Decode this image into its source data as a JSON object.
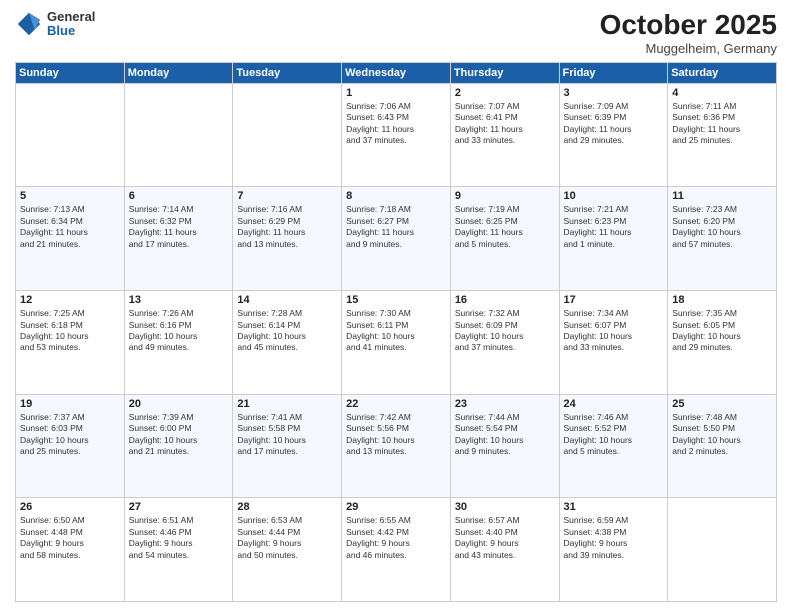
{
  "logo": {
    "general": "General",
    "blue": "Blue"
  },
  "header": {
    "month": "October 2025",
    "location": "Muggelheim, Germany"
  },
  "weekdays": [
    "Sunday",
    "Monday",
    "Tuesday",
    "Wednesday",
    "Thursday",
    "Friday",
    "Saturday"
  ],
  "weeks": [
    [
      {
        "day": "",
        "info": ""
      },
      {
        "day": "",
        "info": ""
      },
      {
        "day": "",
        "info": ""
      },
      {
        "day": "1",
        "info": "Sunrise: 7:06 AM\nSunset: 6:43 PM\nDaylight: 11 hours\nand 37 minutes."
      },
      {
        "day": "2",
        "info": "Sunrise: 7:07 AM\nSunset: 6:41 PM\nDaylight: 11 hours\nand 33 minutes."
      },
      {
        "day": "3",
        "info": "Sunrise: 7:09 AM\nSunset: 6:39 PM\nDaylight: 11 hours\nand 29 minutes."
      },
      {
        "day": "4",
        "info": "Sunrise: 7:11 AM\nSunset: 6:36 PM\nDaylight: 11 hours\nand 25 minutes."
      }
    ],
    [
      {
        "day": "5",
        "info": "Sunrise: 7:13 AM\nSunset: 6:34 PM\nDaylight: 11 hours\nand 21 minutes."
      },
      {
        "day": "6",
        "info": "Sunrise: 7:14 AM\nSunset: 6:32 PM\nDaylight: 11 hours\nand 17 minutes."
      },
      {
        "day": "7",
        "info": "Sunrise: 7:16 AM\nSunset: 6:29 PM\nDaylight: 11 hours\nand 13 minutes."
      },
      {
        "day": "8",
        "info": "Sunrise: 7:18 AM\nSunset: 6:27 PM\nDaylight: 11 hours\nand 9 minutes."
      },
      {
        "day": "9",
        "info": "Sunrise: 7:19 AM\nSunset: 6:25 PM\nDaylight: 11 hours\nand 5 minutes."
      },
      {
        "day": "10",
        "info": "Sunrise: 7:21 AM\nSunset: 6:23 PM\nDaylight: 11 hours\nand 1 minute."
      },
      {
        "day": "11",
        "info": "Sunrise: 7:23 AM\nSunset: 6:20 PM\nDaylight: 10 hours\nand 57 minutes."
      }
    ],
    [
      {
        "day": "12",
        "info": "Sunrise: 7:25 AM\nSunset: 6:18 PM\nDaylight: 10 hours\nand 53 minutes."
      },
      {
        "day": "13",
        "info": "Sunrise: 7:26 AM\nSunset: 6:16 PM\nDaylight: 10 hours\nand 49 minutes."
      },
      {
        "day": "14",
        "info": "Sunrise: 7:28 AM\nSunset: 6:14 PM\nDaylight: 10 hours\nand 45 minutes."
      },
      {
        "day": "15",
        "info": "Sunrise: 7:30 AM\nSunset: 6:11 PM\nDaylight: 10 hours\nand 41 minutes."
      },
      {
        "day": "16",
        "info": "Sunrise: 7:32 AM\nSunset: 6:09 PM\nDaylight: 10 hours\nand 37 minutes."
      },
      {
        "day": "17",
        "info": "Sunrise: 7:34 AM\nSunset: 6:07 PM\nDaylight: 10 hours\nand 33 minutes."
      },
      {
        "day": "18",
        "info": "Sunrise: 7:35 AM\nSunset: 6:05 PM\nDaylight: 10 hours\nand 29 minutes."
      }
    ],
    [
      {
        "day": "19",
        "info": "Sunrise: 7:37 AM\nSunset: 6:03 PM\nDaylight: 10 hours\nand 25 minutes."
      },
      {
        "day": "20",
        "info": "Sunrise: 7:39 AM\nSunset: 6:00 PM\nDaylight: 10 hours\nand 21 minutes."
      },
      {
        "day": "21",
        "info": "Sunrise: 7:41 AM\nSunset: 5:58 PM\nDaylight: 10 hours\nand 17 minutes."
      },
      {
        "day": "22",
        "info": "Sunrise: 7:42 AM\nSunset: 5:56 PM\nDaylight: 10 hours\nand 13 minutes."
      },
      {
        "day": "23",
        "info": "Sunrise: 7:44 AM\nSunset: 5:54 PM\nDaylight: 10 hours\nand 9 minutes."
      },
      {
        "day": "24",
        "info": "Sunrise: 7:46 AM\nSunset: 5:52 PM\nDaylight: 10 hours\nand 5 minutes."
      },
      {
        "day": "25",
        "info": "Sunrise: 7:48 AM\nSunset: 5:50 PM\nDaylight: 10 hours\nand 2 minutes."
      }
    ],
    [
      {
        "day": "26",
        "info": "Sunrise: 6:50 AM\nSunset: 4:48 PM\nDaylight: 9 hours\nand 58 minutes."
      },
      {
        "day": "27",
        "info": "Sunrise: 6:51 AM\nSunset: 4:46 PM\nDaylight: 9 hours\nand 54 minutes."
      },
      {
        "day": "28",
        "info": "Sunrise: 6:53 AM\nSunset: 4:44 PM\nDaylight: 9 hours\nand 50 minutes."
      },
      {
        "day": "29",
        "info": "Sunrise: 6:55 AM\nSunset: 4:42 PM\nDaylight: 9 hours\nand 46 minutes."
      },
      {
        "day": "30",
        "info": "Sunrise: 6:57 AM\nSunset: 4:40 PM\nDaylight: 9 hours\nand 43 minutes."
      },
      {
        "day": "31",
        "info": "Sunrise: 6:59 AM\nSunset: 4:38 PM\nDaylight: 9 hours\nand 39 minutes."
      },
      {
        "day": "",
        "info": ""
      }
    ]
  ]
}
